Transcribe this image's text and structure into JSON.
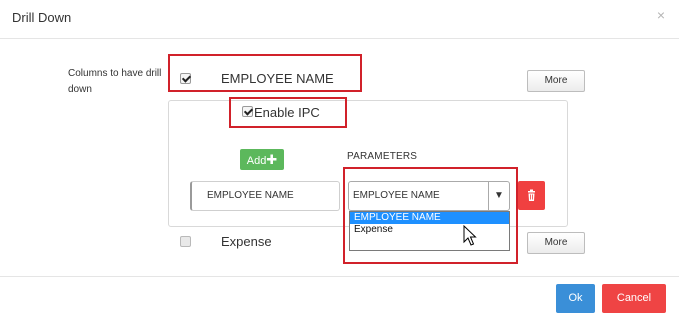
{
  "dialog": {
    "title": "Drill Down",
    "close_icon": "close-icon"
  },
  "columns_label": "Columns to have drill down",
  "columns": [
    {
      "name": "EMPLOYEE NAME",
      "checked": true,
      "more_label": "More"
    },
    {
      "name": "Expense",
      "checked": false,
      "more_label": "More"
    }
  ],
  "ipc": {
    "label": "Enable IPC",
    "checked": true
  },
  "add_button": {
    "label": "Add",
    "icon": "plus-icon"
  },
  "parameters": {
    "heading": "PARAMETERS",
    "row": {
      "input_value": "EMPLOYEE NAME",
      "select_value": "EMPLOYEE NAME",
      "options": [
        "EMPLOYEE NAME",
        "Expense"
      ],
      "highlighted_option": "EMPLOYEE NAME"
    },
    "delete_icon": "trash-icon"
  },
  "footer": {
    "ok_label": "Ok",
    "cancel_label": "Cancel"
  },
  "colors": {
    "add_green": "#5cb85c",
    "delete_red": "#f04040",
    "ok_blue": "#3a8fd8",
    "cancel_red": "#ef4444",
    "highlight_red": "#d1212a",
    "option_selected": "#1e90ff"
  }
}
